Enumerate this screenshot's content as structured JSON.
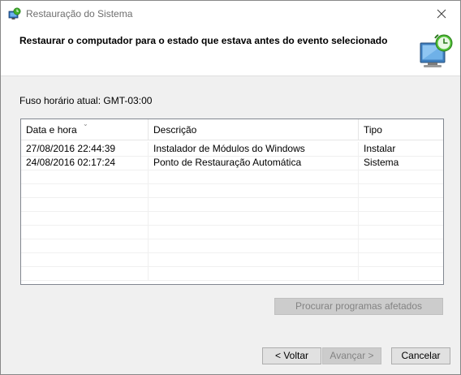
{
  "window": {
    "title": "Restauração do Sistema",
    "title_icon": "system-restore-icon",
    "close_icon": "close-icon"
  },
  "header": {
    "instruction": "Restaurar o computador para o estado que estava antes do evento selecionado",
    "art_icon": "system-restore-monitor-icon"
  },
  "timezone_label": "Fuso horário atual: GMT-03:00",
  "table": {
    "columns": [
      "Data e hora",
      "Descrição",
      "Tipo"
    ],
    "sorted_column": "Data e hora",
    "rows": [
      {
        "date": "27/08/2016 22:44:39",
        "description": "Instalador de Módulos do Windows",
        "type": "Instalar"
      },
      {
        "date": "24/08/2016 02:17:24",
        "description": "Ponto de Restauração Automática",
        "type": "Sistema"
      }
    ]
  },
  "buttons": {
    "scan": "Procurar programas afetados",
    "back": "< Voltar",
    "next": "Avançar >",
    "cancel": "Cancelar"
  },
  "colors": {
    "window_bg": "#f0f0f0",
    "disabled_text": "#838383",
    "list_border": "#828790"
  }
}
